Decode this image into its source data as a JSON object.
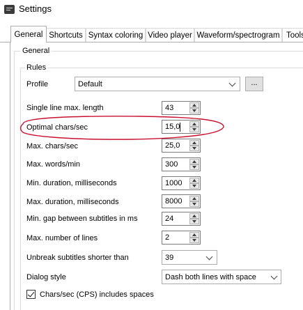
{
  "window": {
    "title": "Settings",
    "icon": "app-icon"
  },
  "tabs": [
    {
      "label": "General",
      "active": true
    },
    {
      "label": "Shortcuts"
    },
    {
      "label": "Syntax coloring"
    },
    {
      "label": "Video player"
    },
    {
      "label": "Waveform/spectrogram"
    },
    {
      "label": "Tools"
    }
  ],
  "general_group": {
    "label": "General"
  },
  "rules": {
    "label": "Rules",
    "profile": {
      "label": "Profile",
      "value": "Default",
      "more_button": "..."
    },
    "fields": [
      {
        "label": "Single line max. length",
        "value": "43"
      },
      {
        "label": "Optimal chars/sec",
        "value": "15,0"
      },
      {
        "label": "Max. chars/sec",
        "value": "25,0"
      },
      {
        "label": "Max. words/min",
        "value": "300"
      },
      {
        "label": "Min. duration, milliseconds",
        "value": "1000"
      },
      {
        "label": "Max. duration, milliseconds",
        "value": "8000"
      },
      {
        "label": "Min. gap between subtitles in ms",
        "value": "24"
      },
      {
        "label": "Max. number of lines",
        "value": "2"
      }
    ],
    "unbreak": {
      "label": "Unbreak subtitles shorter than",
      "value": "39"
    },
    "dialog_style": {
      "label": "Dialog style",
      "value": "Dash both lines with space"
    },
    "cps_spaces": {
      "label": "Chars/sec (CPS) includes spaces",
      "checked": true
    }
  },
  "colors": {
    "annotation": "#c8102e"
  }
}
